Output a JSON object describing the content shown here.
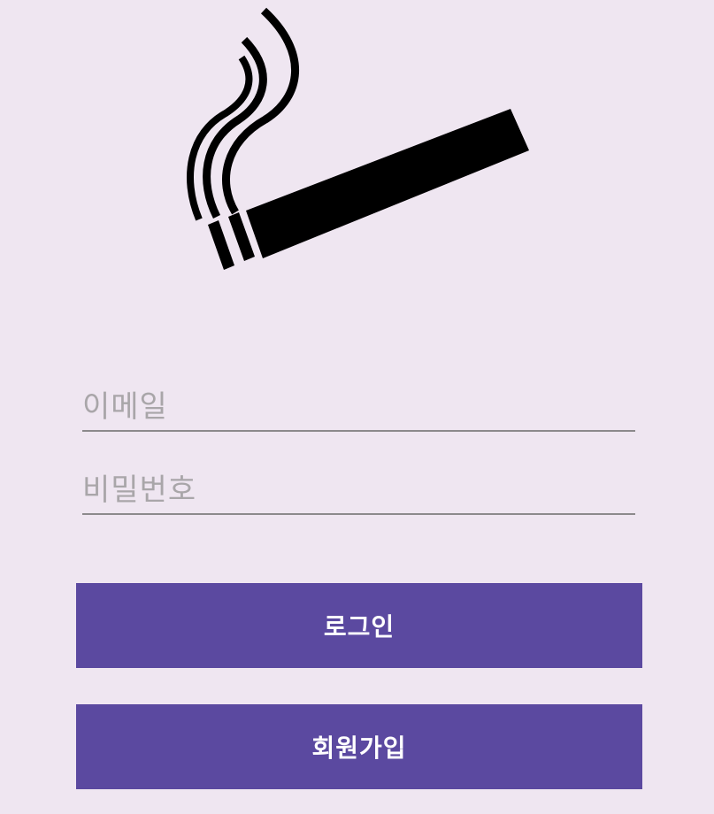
{
  "logo": {
    "icon": "smoking-icon"
  },
  "form": {
    "email_placeholder": "이메일",
    "password_placeholder": "비밀번호",
    "email_value": "",
    "password_value": ""
  },
  "buttons": {
    "login_label": "로그인",
    "signup_label": "회원가입"
  },
  "colors": {
    "background": "#efe6f1",
    "button": "#5b49a0",
    "underline": "#8c8a8c"
  }
}
